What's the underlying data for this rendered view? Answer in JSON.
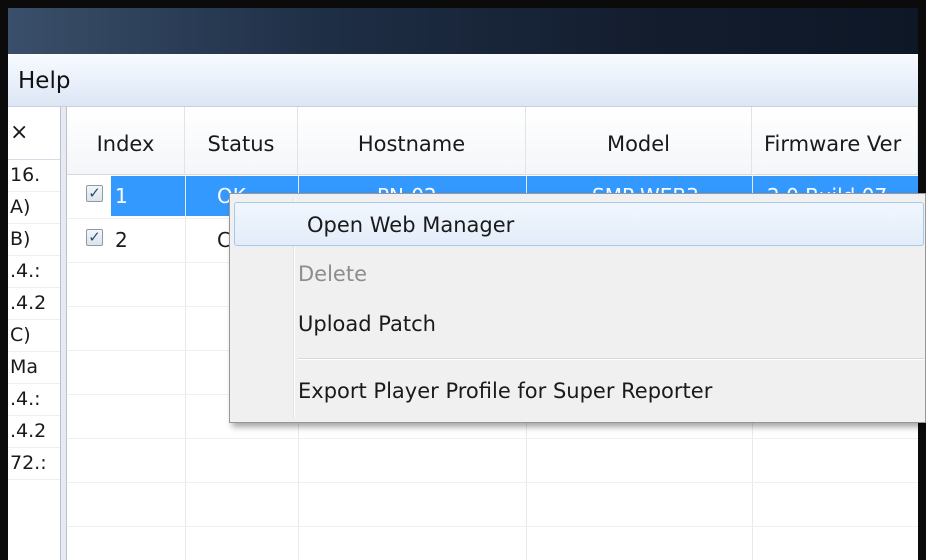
{
  "menubar": {
    "help": "Help"
  },
  "left_pane": {
    "header": "×",
    "rows": [
      "16.",
      "A)",
      "B)",
      ".4.:",
      ".4.2",
      "C)",
      "Ma",
      ".4.:",
      ".4.2",
      "72.:"
    ]
  },
  "grid": {
    "columns": [
      "Index",
      "Status",
      "Hostname",
      "Model",
      "Firmware Ver"
    ],
    "rows": [
      {
        "checked": true,
        "index": "1",
        "status": "OK",
        "hostname": "PN-02",
        "model": "SMP-WEB3",
        "firmware": "2.0 Build 07"
      },
      {
        "checked": true,
        "index": "2",
        "status": "C",
        "hostname": "",
        "model": "",
        "firmware": ""
      }
    ]
  },
  "context_menu": {
    "items": [
      {
        "label": "Open Web Manager",
        "state": "hover"
      },
      {
        "label": "Delete",
        "state": "disabled"
      },
      {
        "label": "Upload Patch",
        "state": "normal"
      },
      {
        "label": "Export Player Profile for Super Reporter",
        "state": "normal"
      }
    ]
  },
  "colors": {
    "selection": "#3399ff",
    "title_bar": "#1e2e45",
    "menu_hover_border": "#a8c8eb"
  }
}
